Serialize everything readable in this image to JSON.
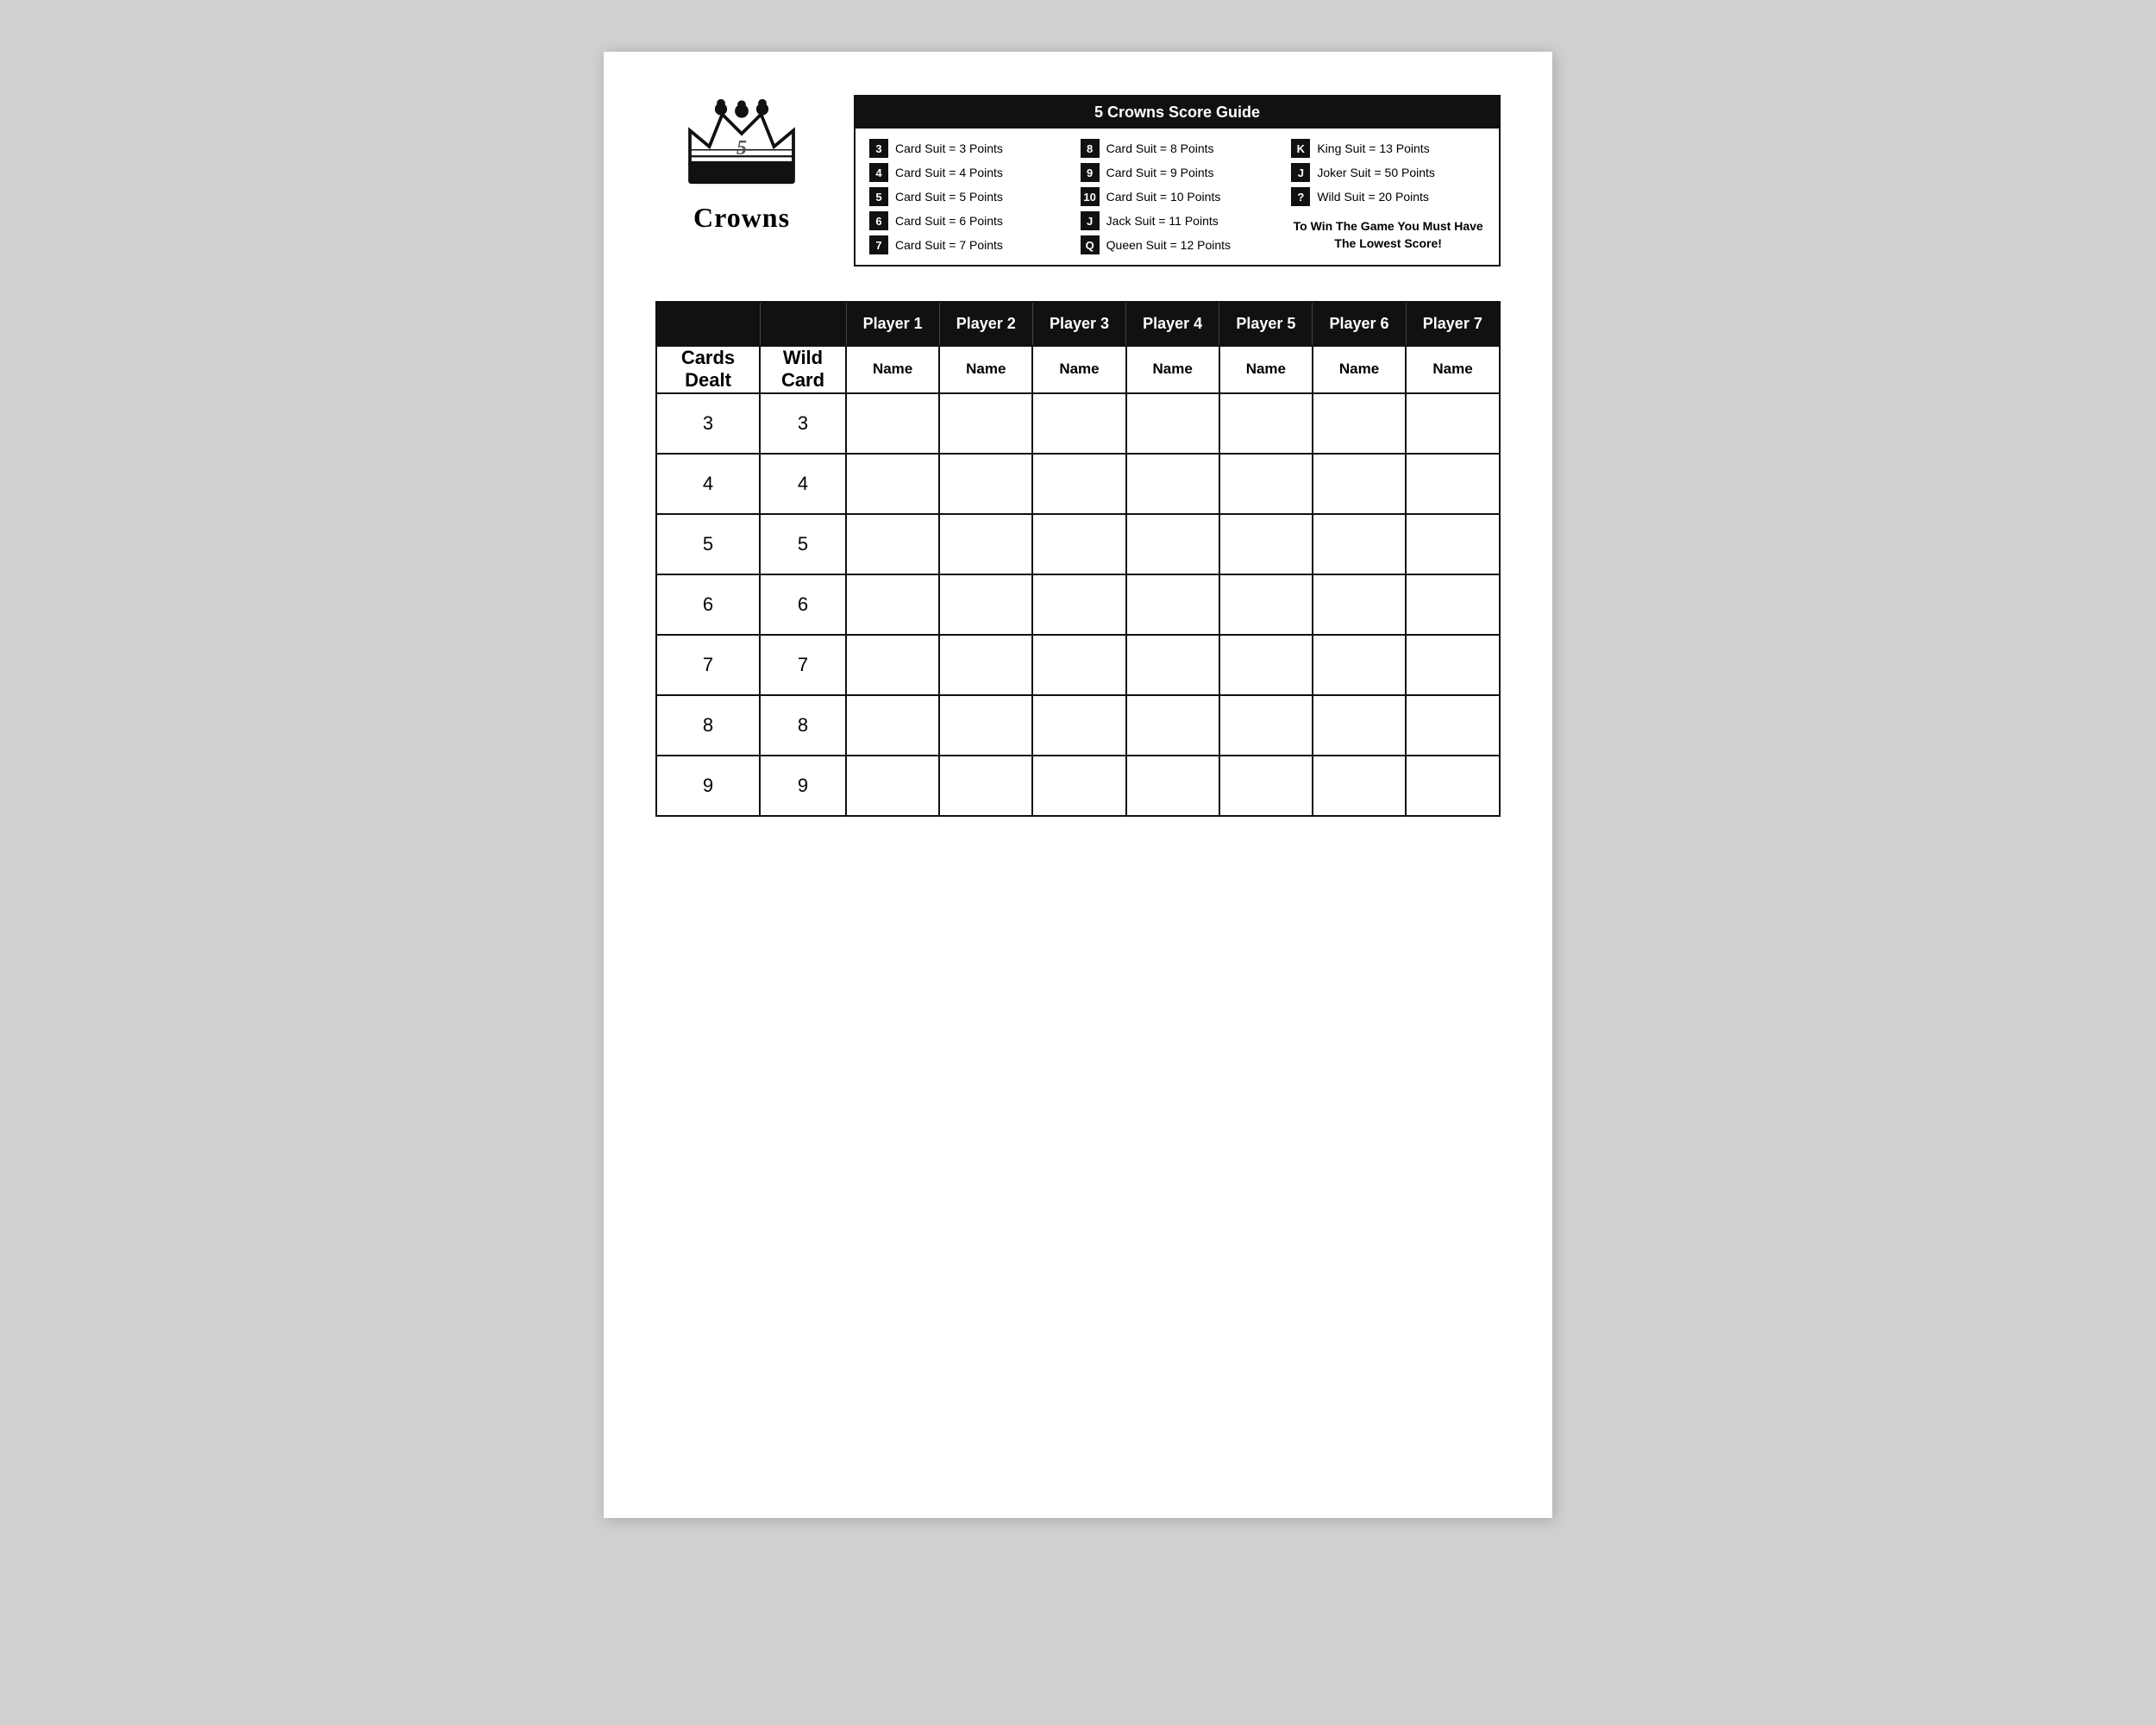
{
  "header": {
    "logo_title": "Crowns",
    "score_guide_title": "5 Crowns Score Guide"
  },
  "score_guide": {
    "col1": [
      {
        "badge": "3",
        "text": "Card Suit = 3 Points"
      },
      {
        "badge": "4",
        "text": "Card Suit = 4 Points"
      },
      {
        "badge": "5",
        "text": "Card Suit = 5 Points"
      },
      {
        "badge": "6",
        "text": "Card Suit = 6 Points"
      },
      {
        "badge": "7",
        "text": "Card Suit = 7 Points"
      }
    ],
    "col2": [
      {
        "badge": "8",
        "text": "Card Suit = 8 Points"
      },
      {
        "badge": "9",
        "text": "Card Suit = 9 Points"
      },
      {
        "badge": "10",
        "text": "Card Suit = 10 Points"
      },
      {
        "badge": "J",
        "text": "Jack Suit = 11 Points"
      },
      {
        "badge": "Q",
        "text": "Queen Suit = 12 Points"
      }
    ],
    "col3": [
      {
        "badge": "K",
        "text": "King Suit = 13 Points"
      },
      {
        "badge": "J",
        "text": "Joker Suit = 50 Points"
      },
      {
        "badge": "?",
        "text": "Wild Suit = 20 Points"
      }
    ],
    "win_text": "To Win The Game You Must\nHave The Lowest Score!"
  },
  "table": {
    "players": [
      "Player 1",
      "Player 2",
      "Player 3",
      "Player 4",
      "Player 5",
      "Player 6",
      "Player 7"
    ],
    "name_label": "Name",
    "col1_label": "Cards\nDealt",
    "col2_label": "Wild\nCard",
    "rows": [
      {
        "cards": "3",
        "wild": "3"
      },
      {
        "cards": "4",
        "wild": "4"
      },
      {
        "cards": "5",
        "wild": "5"
      },
      {
        "cards": "6",
        "wild": "6"
      },
      {
        "cards": "7",
        "wild": "7"
      },
      {
        "cards": "8",
        "wild": "8"
      },
      {
        "cards": "9",
        "wild": "9"
      }
    ]
  }
}
